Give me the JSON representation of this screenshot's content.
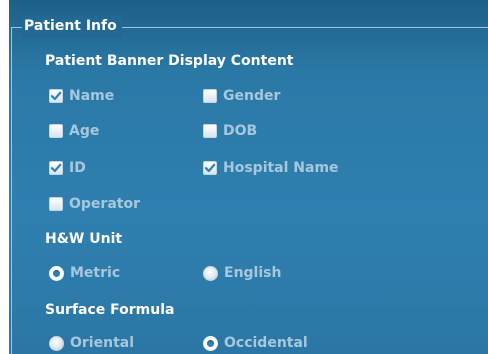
{
  "group": {
    "title": "Patient Info"
  },
  "banner": {
    "title": "Patient Banner Display Content",
    "options": [
      {
        "label": "Name",
        "checked": true
      },
      {
        "label": "Gender",
        "checked": false
      },
      {
        "label": "Age",
        "checked": false
      },
      {
        "label": "DOB",
        "checked": false
      },
      {
        "label": "ID",
        "checked": true
      },
      {
        "label": "Hospital Name",
        "checked": true
      },
      {
        "label": "Operator",
        "checked": false
      }
    ]
  },
  "hw_unit": {
    "title": "H&W Unit",
    "options": [
      {
        "label": "Metric",
        "selected": true
      },
      {
        "label": "English",
        "selected": false
      }
    ]
  },
  "surface_formula": {
    "title": "Surface Formula",
    "options": [
      {
        "label": "Oriental",
        "selected": false
      },
      {
        "label": "Occidental",
        "selected": true
      }
    ]
  },
  "colors": {
    "panel_background": "#2f80b0",
    "frame_line": "#9fc5dd",
    "title_text": "#ffffff",
    "option_text": "#a7c8dc",
    "check_mark": "#2f80b0"
  },
  "icons": {
    "checkbox_checked": "checkbox-checked-icon",
    "checkbox_unchecked": "checkbox-unchecked-icon",
    "radio_selected": "radio-selected-icon",
    "radio_unselected": "radio-unselected-icon"
  }
}
